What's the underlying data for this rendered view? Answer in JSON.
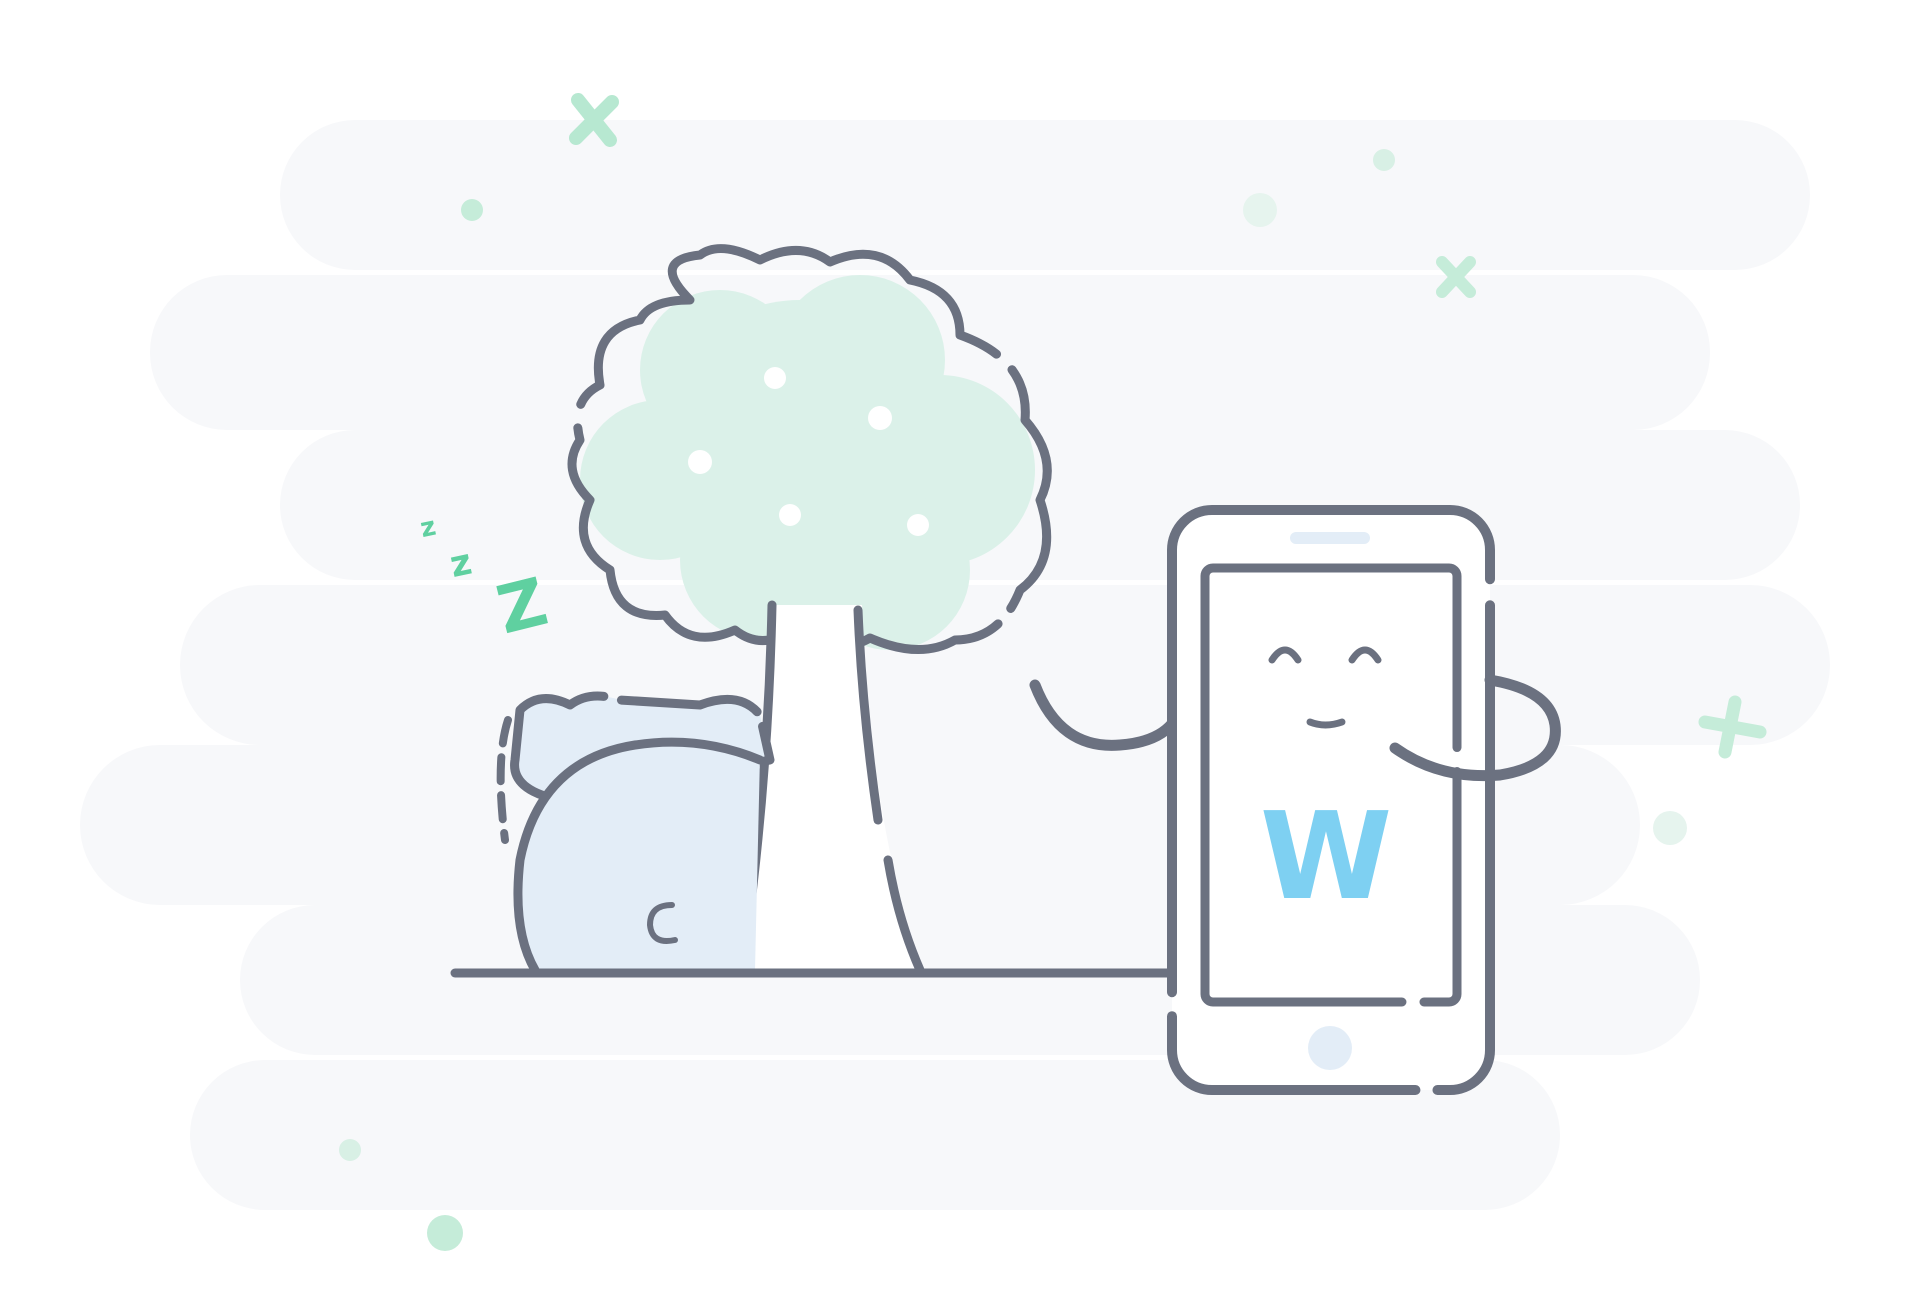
{
  "illustration": {
    "phone_logo_letter": "W",
    "sleep_letters": [
      "z",
      "z",
      "Z"
    ]
  },
  "colors": {
    "background": "#ffffff",
    "cloud_band": "#f7f8fa",
    "outline": "#6b7180",
    "foliage": "#dbf1e9",
    "sparkle": "#c5ecd9",
    "sparkle_strong": "#9fe0c3",
    "sleep_text": "#5fd0a0",
    "sleeper_fill": "#e3edf7",
    "phone_logo": "#7ed0f2",
    "phone_button": "#e3edf7"
  },
  "icons": [
    "sparkle-cross-icon",
    "sparkle-dot-icon",
    "sleep-z-icon",
    "phone-home-button-icon"
  ]
}
